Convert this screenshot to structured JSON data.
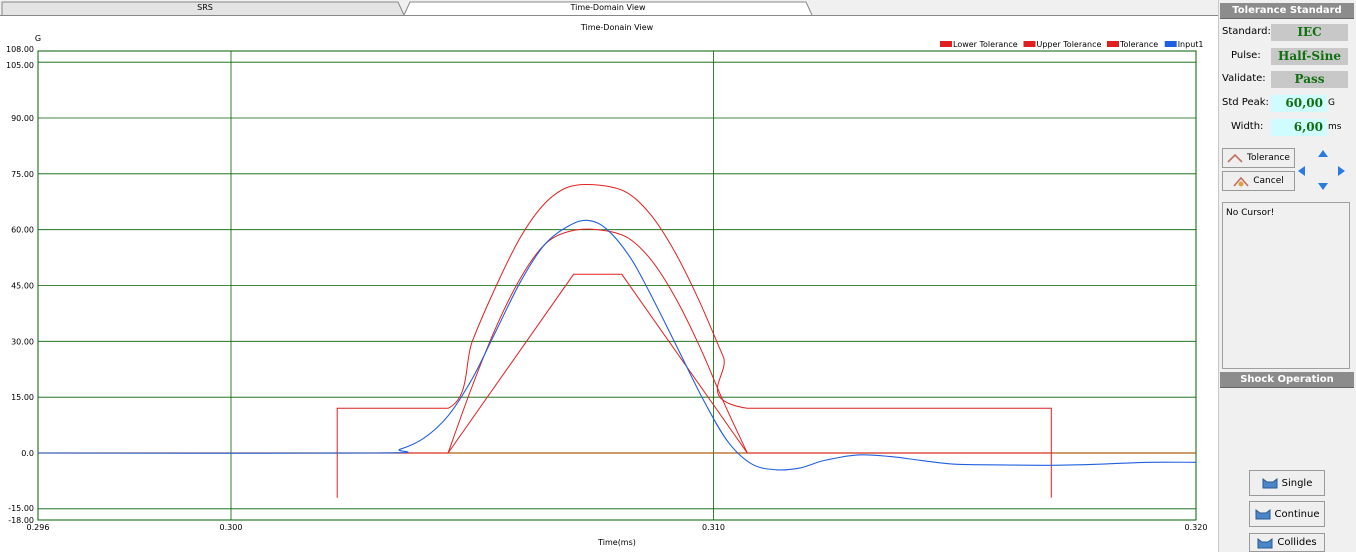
{
  "tabs": [
    "SRS",
    "Time-Domain View"
  ],
  "chart": {
    "title": "Time-Donain View",
    "ylabel_unit": "G",
    "xlabel": "Time(ms)",
    "legend": [
      {
        "label": "Lower Tolerance",
        "color": "#e02020"
      },
      {
        "label": "Upper Tolerance",
        "color": "#e02020"
      },
      {
        "label": "Tolerance",
        "color": "#e02020"
      },
      {
        "label": "Input1",
        "color": "#2060e0"
      }
    ],
    "x_ticks": [
      "0.296",
      "0.300",
      "0.310",
      "0.320"
    ],
    "y_ticks": [
      "108.00",
      "105.00",
      "90.00",
      "75.00",
      "60.00",
      "45.00",
      "30.00",
      "15.00",
      "0.0",
      "-15.00",
      "-18.00"
    ]
  },
  "chart_data": {
    "type": "line",
    "title": "Time-Donain View",
    "xlabel": "Time(ms)",
    "ylabel": "G",
    "xlim": [
      0.296,
      0.32
    ],
    "ylim": [
      -18,
      108
    ],
    "grid": true,
    "legend_position": "top-right",
    "series": [
      {
        "name": "Lower Tolerance",
        "color": "#e02020",
        "x": [
          0.3022,
          0.3022,
          0.3045,
          0.3071,
          0.3081,
          0.3107,
          0.317,
          0.317
        ],
        "y": [
          -12,
          0,
          0,
          48,
          48,
          0,
          0,
          -12
        ]
      },
      {
        "name": "Upper Tolerance",
        "color": "#e02020",
        "x": [
          0.3022,
          0.3022,
          0.3045,
          0.305,
          0.3055,
          0.306,
          0.3065,
          0.307,
          0.3076,
          0.3082,
          0.3087,
          0.3092,
          0.3097,
          0.3102,
          0.3107,
          0.317,
          0.317
        ],
        "y": [
          0,
          12,
          12,
          30,
          45,
          58,
          67,
          71.5,
          72,
          70,
          64,
          54,
          41,
          26,
          12,
          12,
          0
        ]
      },
      {
        "name": "Tolerance",
        "color": "#e02020",
        "x": [
          0.3045,
          0.305,
          0.3055,
          0.306,
          0.3065,
          0.307,
          0.3076,
          0.3082,
          0.3087,
          0.3092,
          0.3097,
          0.3102,
          0.3107
        ],
        "y": [
          0,
          18,
          34,
          47,
          56,
          59.5,
          60,
          58,
          52,
          42,
          29,
          14,
          0
        ]
      },
      {
        "name": "Input1",
        "color": "#2060e0",
        "x": [
          0.296,
          0.303,
          0.3035,
          0.304,
          0.3045,
          0.305,
          0.3055,
          0.306,
          0.3065,
          0.307,
          0.3074,
          0.3078,
          0.3083,
          0.3088,
          0.3093,
          0.3098,
          0.3103,
          0.3108,
          0.3113,
          0.3118,
          0.3123,
          0.313,
          0.3137,
          0.3143,
          0.315,
          0.316,
          0.317,
          0.318,
          0.319,
          0.32
        ],
        "y": [
          0,
          0,
          1,
          4,
          10,
          20,
          33,
          46,
          56,
          61,
          62.5,
          60,
          52,
          40,
          27,
          14,
          3,
          -3,
          -4.5,
          -4,
          -2,
          -0.5,
          -1,
          -2,
          -3,
          -3.2,
          -3.3,
          -3,
          -2.5,
          -2.5
        ]
      }
    ]
  },
  "side": {
    "tolerance_header": "Tolerance Standard",
    "standard_label": "Standard:",
    "standard_value": "IEC",
    "pulse_label": "Pulse:",
    "pulse_value": "Half-Sine",
    "validate_label": "Validate:",
    "validate_value": "Pass",
    "std_peak_label": "Std Peak:",
    "std_peak_value": "60,00",
    "std_peak_unit": "G",
    "width_label": "Width:",
    "width_value": "6,00",
    "width_unit": "ms",
    "tolerance_button": "Tolerance",
    "cancel_button": "Cancel",
    "cursor_text": "No Cursor!",
    "shock_header": "Shock Operation",
    "single_button": "Single",
    "continue_button": "Continue",
    "collides_button": "Collides"
  }
}
